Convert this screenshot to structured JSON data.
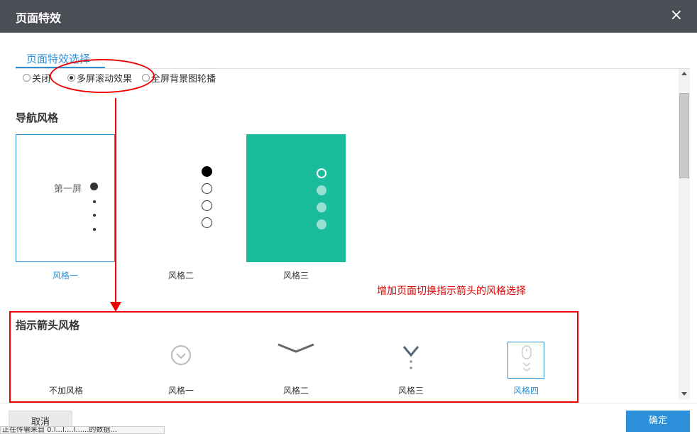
{
  "dialog": {
    "title": "页面特效",
    "close_glyph": "×"
  },
  "tab": {
    "label": "页面特效选择"
  },
  "radios": [
    {
      "label": "关闭",
      "checked": false
    },
    {
      "label": "多屏滚动效果",
      "checked": true
    },
    {
      "label": "全屏背景图轮播",
      "checked": false
    }
  ],
  "nav_section": {
    "heading": "导航风格",
    "styles": [
      {
        "label": "风格一",
        "selected": true,
        "sample_text": "第一屏"
      },
      {
        "label": "风格二",
        "selected": false
      },
      {
        "label": "风格三",
        "selected": false
      }
    ],
    "accent_color": "#1abc9c"
  },
  "annotation": {
    "text": "增加页面切换指示箭头的风格选择",
    "color": "#dd0000"
  },
  "arrow_section": {
    "heading": "指示箭头风格",
    "styles": [
      {
        "label": "不加风格",
        "selected": false
      },
      {
        "label": "风格一",
        "selected": false
      },
      {
        "label": "风格二",
        "selected": false
      },
      {
        "label": "风格三",
        "selected": false
      },
      {
        "label": "风格四",
        "selected": true
      }
    ]
  },
  "footer": {
    "cancel_label": "取消",
    "ok_label": "确定",
    "ok_color": "#2b90d9"
  },
  "status": {
    "text": "正在传输来自 0.l...l....l......的数据..."
  }
}
